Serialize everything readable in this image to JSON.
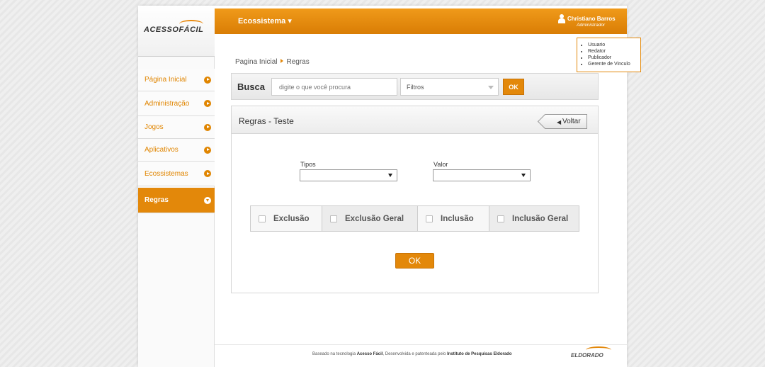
{
  "logo": {
    "text": "ACESSOFÁCIL"
  },
  "sidebar": {
    "items": [
      {
        "label": "Página Inicial"
      },
      {
        "label": "Administração"
      },
      {
        "label": "Jogos"
      },
      {
        "label": "Aplicativos"
      },
      {
        "label": "Ecossistemas"
      },
      {
        "label": "Regras",
        "active": true
      }
    ]
  },
  "header": {
    "menu_label": "Ecossistema ▾",
    "user_name": "Christiano Barros",
    "user_role": "Administrador",
    "user_menu": [
      "Usuario",
      "Redator",
      "Publicador",
      "Gerente de Vinculo"
    ]
  },
  "breadcrumb": {
    "home": "Pagina Inicial",
    "current": "Regras"
  },
  "search": {
    "label": "Busca",
    "placeholder": "digite o que você procura",
    "filter": "Filtros",
    "ok": "OK"
  },
  "panel": {
    "title": "Regras - Teste",
    "back_label": "Voltar",
    "back_icon": "arrow-left-icon",
    "tipos_label": "Tipos",
    "valor_label": "Valor",
    "checks": [
      "Exclusão",
      "Exclusão Geral",
      "Inclusão",
      "Inclusão Geral"
    ],
    "ok": "OK"
  },
  "footer": {
    "text_prefix": "Baseado na tecnologia ",
    "brand": "Acesso Fácil",
    "text_middle": ", Desenvolvida e patenteada pelo ",
    "institute": "Instituto de Pesquisas Eldorado",
    "logo": "ELDORADO"
  },
  "colors": {
    "accent": "#e3880a",
    "header": "#e88a10"
  }
}
